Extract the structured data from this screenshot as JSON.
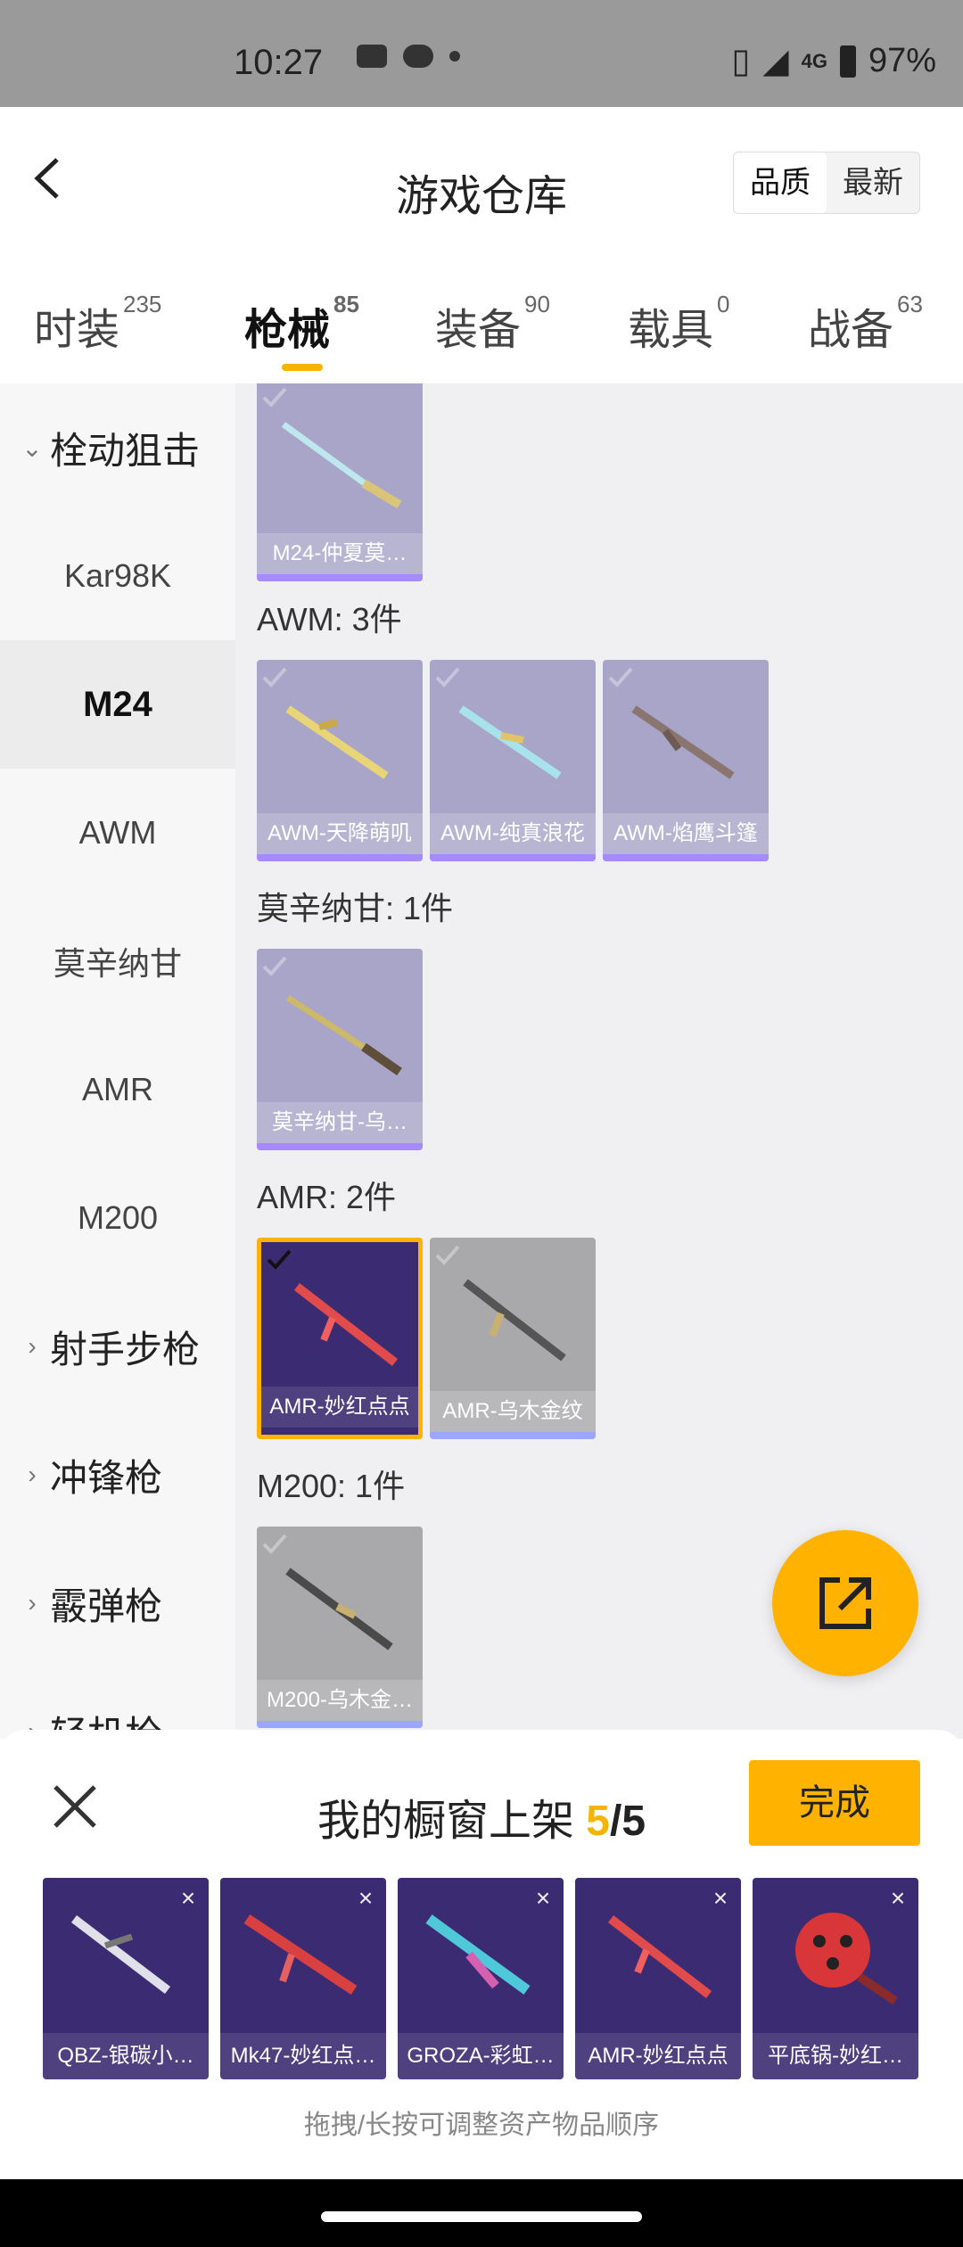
{
  "status": {
    "time": "10:27",
    "network": "4G",
    "battery": "97%"
  },
  "header": {
    "title": "游戏仓库",
    "sort_quality": "品质",
    "sort_newest": "最新"
  },
  "tabs": [
    {
      "label": "时装",
      "count": "235"
    },
    {
      "label": "枪械",
      "count": "85"
    },
    {
      "label": "装备",
      "count": "90"
    },
    {
      "label": "载具",
      "count": "0"
    },
    {
      "label": "战备",
      "count": "63"
    }
  ],
  "sidebar": {
    "category_bolt": "栓动狙击",
    "items": [
      "Kar98K",
      "M24",
      "AWM",
      "莫辛纳甘",
      "AMR",
      "M200"
    ],
    "cat_dmr": "射手步枪",
    "cat_smg": "冲锋枪",
    "cat_shotgun": "霰弹枪",
    "cat_lmg": "轻机枪"
  },
  "content": {
    "m24_item": "M24-仲夏莫…",
    "awm_group": "AWM: 3件",
    "awm_items": [
      "AWM-天降萌叽",
      "AWM-纯真浪花",
      "AWM-焰鹰斗篷"
    ],
    "mosin_group": "莫辛纳甘: 1件",
    "mosin_items": [
      "莫辛纳甘-乌…"
    ],
    "amr_group": "AMR: 2件",
    "amr_items": [
      "AMR-妙红点点",
      "AMR-乌木金纹"
    ],
    "m200_group": "M200: 1件",
    "m200_items": [
      "M200-乌木金…"
    ]
  },
  "bottom": {
    "title": "我的橱窗上架",
    "count": "5",
    "sep": "/",
    "total": "5",
    "done": "完成",
    "shelf": [
      "QBZ-银碳小…",
      "Mk47-妙红点…",
      "GROZA-彩虹…",
      "AMR-妙红点点",
      "平底锅-妙红…"
    ],
    "remove": "×",
    "hint": "拖拽/长按可调整资产物品顺序"
  },
  "colors": {
    "accent": "#ffb300",
    "purple_card": "#a8a5c8",
    "dark_card": "#3b2b72"
  }
}
